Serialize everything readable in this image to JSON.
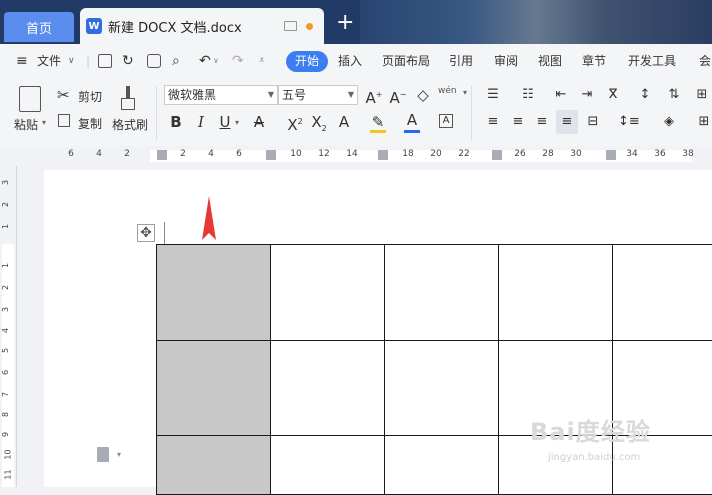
{
  "tabs": {
    "home": "首页",
    "document": "新建 DOCX 文档.docx",
    "doc_icon": "W",
    "add_tab": "+"
  },
  "menu": {
    "file": "文件",
    "items": [
      "开始",
      "插入",
      "页面布局",
      "引用",
      "审阅",
      "视图",
      "章节",
      "开发工具",
      "会"
    ]
  },
  "ribbon": {
    "paste": "粘贴",
    "cut": "剪切",
    "copy": "复制",
    "format_painter": "格式刷",
    "font_name": "微软雅黑",
    "font_size": "五号",
    "pinyin": "wén"
  },
  "ruler": {
    "h_ticks": [
      "6",
      "4",
      "2",
      "2",
      "4",
      "6",
      "10",
      "12",
      "14",
      "18",
      "20",
      "22",
      "26",
      "28",
      "30",
      "34",
      "36",
      "38"
    ],
    "v_ticks": [
      "3",
      "2",
      "1",
      "1",
      "2",
      "3",
      "4",
      "5",
      "6",
      "7",
      "8",
      "9",
      "10",
      "11"
    ]
  },
  "watermark": {
    "main": "Bai度经验",
    "sub": "jingyan.baidu.com"
  },
  "colors": {
    "accent": "#3c7ef0",
    "tab_bar": "#213a66",
    "selected_cell": "#c8c8c8",
    "arrow": "#e53935",
    "highlight": "#f5c518",
    "font_color": "#2962ff"
  }
}
